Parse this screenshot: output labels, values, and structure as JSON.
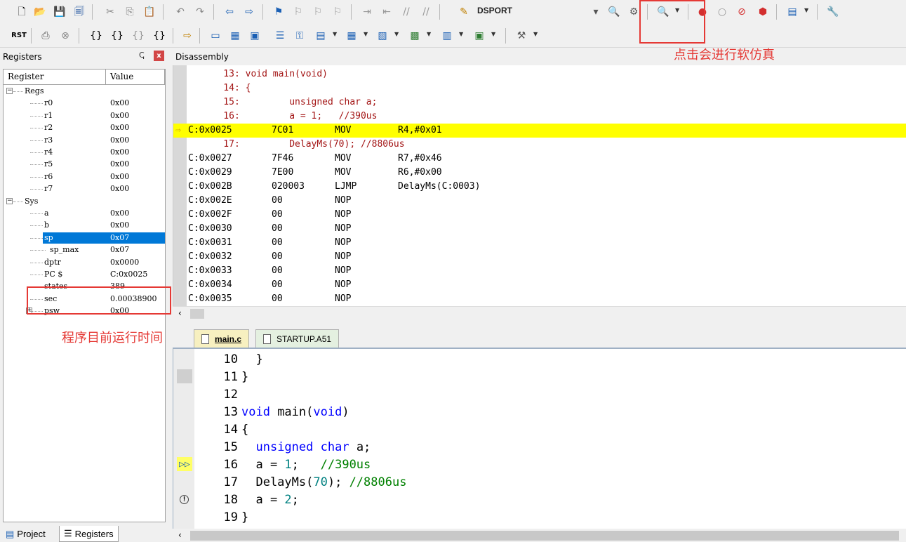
{
  "toolbar1": {
    "target_name": "DSPORT"
  },
  "registers_panel": {
    "title": "Registers",
    "pin_glyph": "ↅ",
    "close_glyph": "x",
    "col_register": "Register",
    "col_value": "Value",
    "rows": [
      {
        "name": "Regs",
        "value": "",
        "expander": "−"
      },
      {
        "name": "r0",
        "value": "0x00"
      },
      {
        "name": "r1",
        "value": "0x00"
      },
      {
        "name": "r2",
        "value": "0x00"
      },
      {
        "name": "r3",
        "value": "0x00"
      },
      {
        "name": "r4",
        "value": "0x00"
      },
      {
        "name": "r5",
        "value": "0x00"
      },
      {
        "name": "r6",
        "value": "0x00"
      },
      {
        "name": "r7",
        "value": "0x00"
      },
      {
        "name": "Sys",
        "value": "",
        "expander": "−"
      },
      {
        "name": "a",
        "value": "0x00"
      },
      {
        "name": "b",
        "value": "0x00"
      },
      {
        "name": "sp",
        "value": "0x07"
      },
      {
        "name": "sp_max",
        "value": "0x07"
      },
      {
        "name": "dptr",
        "value": "0x0000"
      },
      {
        "name": "PC  $",
        "value": "C:0x0025"
      },
      {
        "name": "states",
        "value": "389"
      },
      {
        "name": "sec",
        "value": "0.00038900"
      },
      {
        "name": "psw",
        "value": "0x00",
        "expander": "+"
      }
    ],
    "tabs": {
      "project": "Project",
      "registers": "Registers"
    }
  },
  "disassembly": {
    "title": "Disassembly",
    "lines": [
      {
        "kind": "src",
        "text": "    13: void main(void)"
      },
      {
        "kind": "src",
        "text": "    14: {"
      },
      {
        "kind": "src",
        "text": "    15:         unsigned char a;"
      },
      {
        "kind": "src",
        "text": "    16:         a = 1;   //390us"
      },
      {
        "kind": "asm",
        "addr": "C:0x0025",
        "op": "7C01",
        "mn": "MOV",
        "args": "R4,#0x01",
        "current": true
      },
      {
        "kind": "src",
        "text": "    17:         DelayMs(70); //8806us"
      },
      {
        "kind": "asm",
        "addr": "C:0x0027",
        "op": "7F46",
        "mn": "MOV",
        "args": "R7,#0x46"
      },
      {
        "kind": "asm",
        "addr": "C:0x0029",
        "op": "7E00",
        "mn": "MOV",
        "args": "R6,#0x00"
      },
      {
        "kind": "asm",
        "addr": "C:0x002B",
        "op": "020003",
        "mn": "LJMP",
        "args": "DelayMs(C:0003)"
      },
      {
        "kind": "asm",
        "addr": "C:0x002E",
        "op": "00",
        "mn": "NOP",
        "args": ""
      },
      {
        "kind": "asm",
        "addr": "C:0x002F",
        "op": "00",
        "mn": "NOP",
        "args": ""
      },
      {
        "kind": "asm",
        "addr": "C:0x0030",
        "op": "00",
        "mn": "NOP",
        "args": ""
      },
      {
        "kind": "asm",
        "addr": "C:0x0031",
        "op": "00",
        "mn": "NOP",
        "args": ""
      },
      {
        "kind": "asm",
        "addr": "C:0x0032",
        "op": "00",
        "mn": "NOP",
        "args": ""
      },
      {
        "kind": "asm",
        "addr": "C:0x0033",
        "op": "00",
        "mn": "NOP",
        "args": ""
      },
      {
        "kind": "asm",
        "addr": "C:0x0034",
        "op": "00",
        "mn": "NOP",
        "args": ""
      },
      {
        "kind": "asm",
        "addr": "C:0x0035",
        "op": "00",
        "mn": "NOP",
        "args": ""
      }
    ]
  },
  "source_tabs": {
    "main": "main.c",
    "startup": "STARTUP.A51"
  },
  "source": {
    "lines": [
      {
        "num": "10",
        "segs": [
          {
            "t": "  }",
            "c": ""
          }
        ]
      },
      {
        "num": "11",
        "segs": [
          {
            "t": "}",
            "c": ""
          }
        ],
        "mark": "gray"
      },
      {
        "num": "12",
        "segs": []
      },
      {
        "num": "13",
        "segs": [
          {
            "t": "void",
            "c": "kw"
          },
          {
            "t": " main(",
            "c": ""
          },
          {
            "t": "void",
            "c": "kw"
          },
          {
            "t": ")",
            "c": ""
          }
        ]
      },
      {
        "num": "14",
        "segs": [
          {
            "t": "{",
            "c": ""
          }
        ]
      },
      {
        "num": "15",
        "segs": [
          {
            "t": "  ",
            "c": ""
          },
          {
            "t": "unsigned",
            "c": "kw"
          },
          {
            "t": " ",
            "c": ""
          },
          {
            "t": "char",
            "c": "kw"
          },
          {
            "t": " a;",
            "c": ""
          }
        ]
      },
      {
        "num": "16",
        "segs": [
          {
            "t": "  a = ",
            "c": ""
          },
          {
            "t": "1",
            "c": "nm"
          },
          {
            "t": ";   ",
            "c": ""
          },
          {
            "t": "//390us",
            "c": "cm"
          }
        ],
        "mark": "current"
      },
      {
        "num": "17",
        "segs": [
          {
            "t": "  DelayMs(",
            "c": ""
          },
          {
            "t": "70",
            "c": "nm"
          },
          {
            "t": "); ",
            "c": ""
          },
          {
            "t": "//8806us",
            "c": "cm"
          }
        ]
      },
      {
        "num": "18",
        "segs": [
          {
            "t": "  a = ",
            "c": ""
          },
          {
            "t": "2",
            "c": "nm"
          },
          {
            "t": ";",
            "c": ""
          }
        ],
        "mark": "warn"
      },
      {
        "num": "19",
        "segs": [
          {
            "t": "}",
            "c": ""
          }
        ]
      }
    ],
    "current_marker": "▷▷",
    "warn_marker": "!"
  },
  "annotations": {
    "simulate_note": "点击会进行软仿真",
    "runtime_note": "程序目前运行时间"
  },
  "colors": {
    "accent": "#0078d7",
    "annotation": "#e53935",
    "current_line": "#ffff00"
  }
}
